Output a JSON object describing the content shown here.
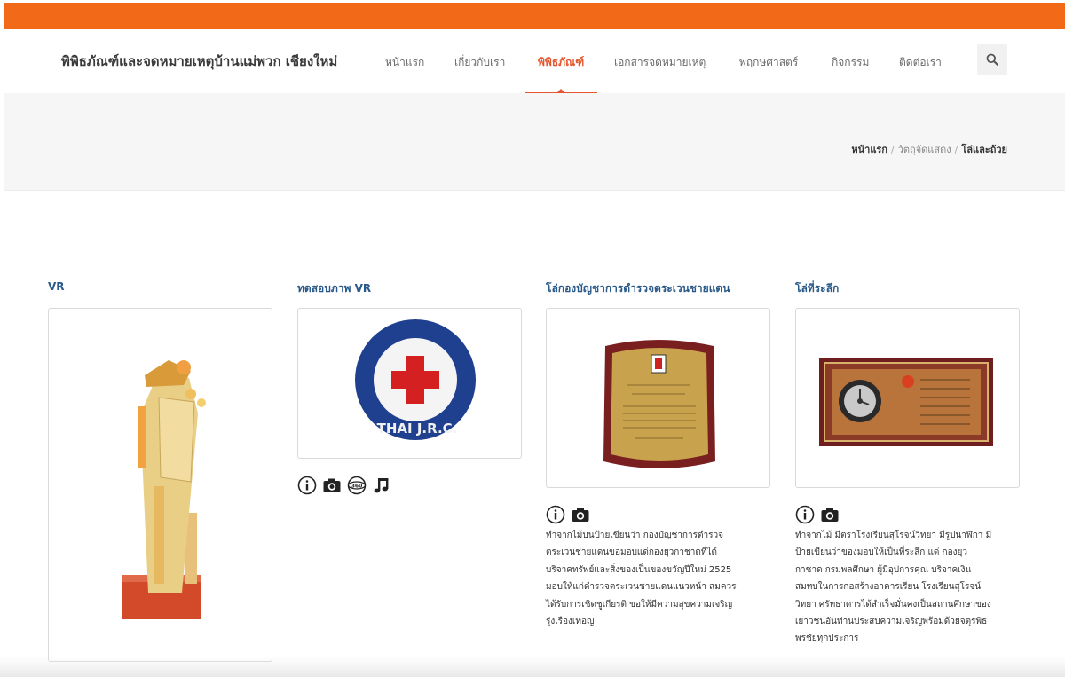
{
  "header": {
    "site_title": "พิพิธภัณฑ์และจดหมายเหตุบ้านแม่พวก เชียงใหม่",
    "nav": [
      {
        "label": "หน้าแรก",
        "active": false
      },
      {
        "label": "เกี่ยวกับเรา",
        "active": false
      },
      {
        "label": "พิพิธภัณฑ์",
        "active": true
      },
      {
        "label": "เอกสารจดหมายเหตุ",
        "active": false
      },
      {
        "label": "พฤกษศาสตร์",
        "active": false
      },
      {
        "label": "กิจกรรม",
        "active": false
      },
      {
        "label": "ติดต่อเรา",
        "active": false
      }
    ],
    "search_icon": "search-icon"
  },
  "breadcrumb": {
    "home": "หน้าแรก",
    "section": "วัตถุจัดแสดง",
    "current": "โล่และถ้วย",
    "separator": "/"
  },
  "cards": [
    {
      "title": "VR",
      "image": "figurine-image",
      "icons": [],
      "description": []
    },
    {
      "title": "ทดสอบภาพ VR",
      "image": "red-cross-badge-image",
      "badge_text": "THAI J.R.C.",
      "icons": [
        "info-icon",
        "camera-icon",
        "360-icon",
        "music-icon"
      ],
      "description": []
    },
    {
      "title": "โล่กองบัญชาการตำรวจตระเวนชายแดน",
      "image": "plaque-image",
      "icons": [
        "info-icon",
        "camera-icon"
      ],
      "description": [
        "ทำจากไม้บนป้ายเขียนว่า กองบัญชาการตำรวจ",
        "ตระเวนชายแดนขอมอบแด่กองยุวกาชาดที่ได้",
        "บริจาคทรัพย์และสิ่งของเป็นของขวัญปีใหม่ 2525",
        "มอบให้แก่ตำรวจตระเวนชายแดนแนวหน้า สมควร",
        "ได้รับการเชิดชูเกียรติ ขอให้มีความสุขความเจริญ",
        "รุ่งเรืองเทอญ"
      ]
    },
    {
      "title": "โล่ที่ระลึก",
      "image": "souvenir-plaque-image",
      "icons": [
        "info-icon",
        "camera-icon"
      ],
      "description": [
        "ทำจากไม้ มีตราโรงเรียนสุโรจน์วิทยา มีรูปนาฬิกา มี",
        "ป้ายเขียนว่าของมอบให้เป็นที่ระลึก แด่ กองยุว",
        "กาชาด กรมพลศึกษา ผู้มีอุปการคุณ บริจาคเงิน",
        "สมทบในการก่อสร้างอาคารเรียน โรงเรียนสุโรจน์",
        "วิทยา ศรัทธาดารได้สำเร็จมั่นคงเป็นสถานศึกษาของ",
        "เยาวชนอันท่านประสบความเจริญพร้อมด้วยจตุรพิธ",
        "พรชัยทุกประการ"
      ]
    }
  ],
  "colors": {
    "topbar": "#f26a17",
    "accent": "#e4572e",
    "title_link": "#2a5a8a"
  }
}
